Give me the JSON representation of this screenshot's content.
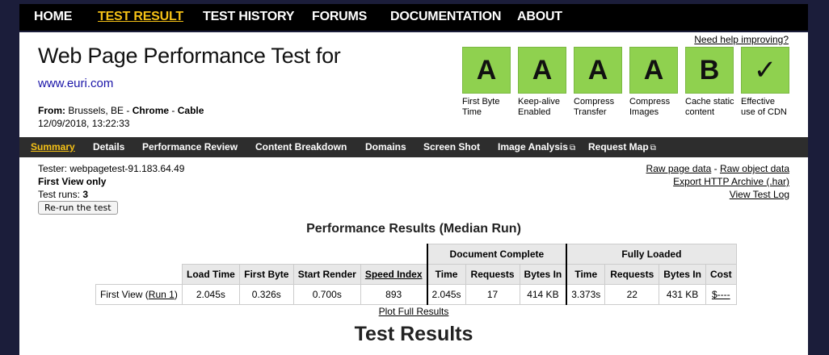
{
  "topnav": {
    "items": [
      "HOME",
      "TEST RESULT",
      "TEST HISTORY",
      "FORUMS",
      "DOCUMENTATION",
      "ABOUT"
    ],
    "active": "TEST RESULT"
  },
  "header": {
    "help_link": "Need help improving?",
    "title": "Web Page Performance Test for",
    "url": "www.euri.com",
    "from_label": "From:",
    "location": "Brussels, BE",
    "browser": "Chrome",
    "connection": "Cable",
    "datetime": "12/09/2018, 13:22:33"
  },
  "grades": [
    {
      "grade": "A",
      "label": "First Byte Time"
    },
    {
      "grade": "A",
      "label": "Keep-alive Enabled"
    },
    {
      "grade": "A",
      "label": "Compress Transfer"
    },
    {
      "grade": "A",
      "label": "Compress Images"
    },
    {
      "grade": "B",
      "label": "Cache static content"
    },
    {
      "grade": "✓",
      "label": "Effective use of CDN"
    }
  ],
  "colors": {
    "grade_green": "#8fd14f",
    "active_nav": "#f5c116",
    "link_blue": "#1a14a8"
  },
  "subnav": {
    "items": [
      "Summary",
      "Details",
      "Performance Review",
      "Content Breakdown",
      "Domains",
      "Screen Shot",
      "Image Analysis",
      "Request Map"
    ],
    "external_icon": "external-link-icon"
  },
  "test_info": {
    "tester": "Tester: webpagetest-91.183.64.49",
    "view": "First View only",
    "runs_label": "Test runs:",
    "runs": "3",
    "rerun_button": "Re-run the test"
  },
  "links": {
    "raw_page_data": "Raw page data",
    "separator": " - ",
    "raw_object_data": "Raw object data",
    "export_har": "Export HTTP Archive (.har)",
    "view_log": "View Test Log"
  },
  "performance": {
    "title": "Performance Results (Median Run)",
    "group_document": "Document Complete",
    "group_fully": "Fully Loaded",
    "columns": [
      "Load Time",
      "First Byte",
      "Start Render",
      "Speed Index",
      "Time",
      "Requests",
      "Bytes In",
      "Time",
      "Requests",
      "Bytes In",
      "Cost"
    ],
    "row": {
      "label": "First View (",
      "run_link": "Run 1",
      "label_close": ")",
      "load_time": "2.045s",
      "first_byte": "0.326s",
      "start_render": "0.700s",
      "speed_index": "893",
      "doc_time": "2.045s",
      "doc_requests": "17",
      "doc_bytes": "414 KB",
      "full_time": "3.373s",
      "full_requests": "22",
      "full_bytes": "431 KB",
      "cost": "$----"
    },
    "plot_link": "Plot Full Results"
  },
  "test_results_heading": "Test Results"
}
